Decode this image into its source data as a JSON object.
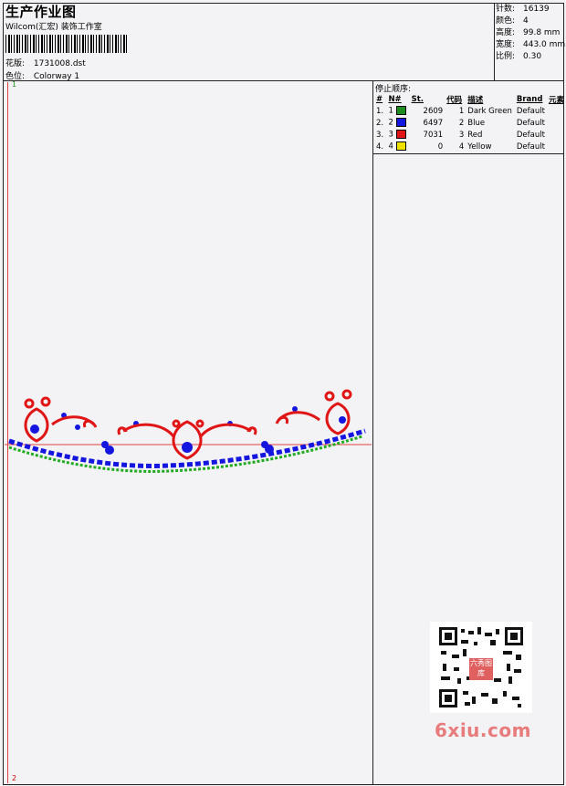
{
  "header": {
    "title": "生产作业图",
    "subtitle": "Wilcom(汇宏) 装饰工作室",
    "design_label": "花版:",
    "design_value": "1731008.dst",
    "colorway_label": "色位:",
    "colorway_value": "Colorway 1"
  },
  "stats": {
    "stitches_label": "针数:",
    "stitches_value": "16139",
    "colors_label": "颜色:",
    "colors_value": "4",
    "height_label": "高度:",
    "height_value": "99.8 mm",
    "width_label": "宽度:",
    "width_value": "443.0 mm",
    "scale_label": "比例:",
    "scale_value": "0.30"
  },
  "stop_sequence": {
    "title": "停止顺序:",
    "headers": [
      "#",
      "N#",
      "St.",
      "代码",
      "描述",
      "Brand",
      "元素"
    ],
    "rows": [
      {
        "index": "1.",
        "n": "1",
        "color": "#1e8c1e",
        "stitches": "2609",
        "code": "1",
        "desc": "Dark Green",
        "brand": "Default"
      },
      {
        "index": "2.",
        "n": "2",
        "color": "#1515e0",
        "stitches": "6497",
        "code": "2",
        "desc": "Blue",
        "brand": "Default"
      },
      {
        "index": "3.",
        "n": "3",
        "color": "#e01515",
        "stitches": "7031",
        "code": "3",
        "desc": "Red",
        "brand": "Default"
      },
      {
        "index": "4.",
        "n": "4",
        "color": "#f0e000",
        "stitches": "0",
        "code": "4",
        "desc": "Yellow",
        "brand": "Default"
      }
    ]
  },
  "markers": {
    "top": "1",
    "bottom": "2"
  },
  "watermark": {
    "site": "6xiu.com",
    "seal": "六秀图库"
  }
}
